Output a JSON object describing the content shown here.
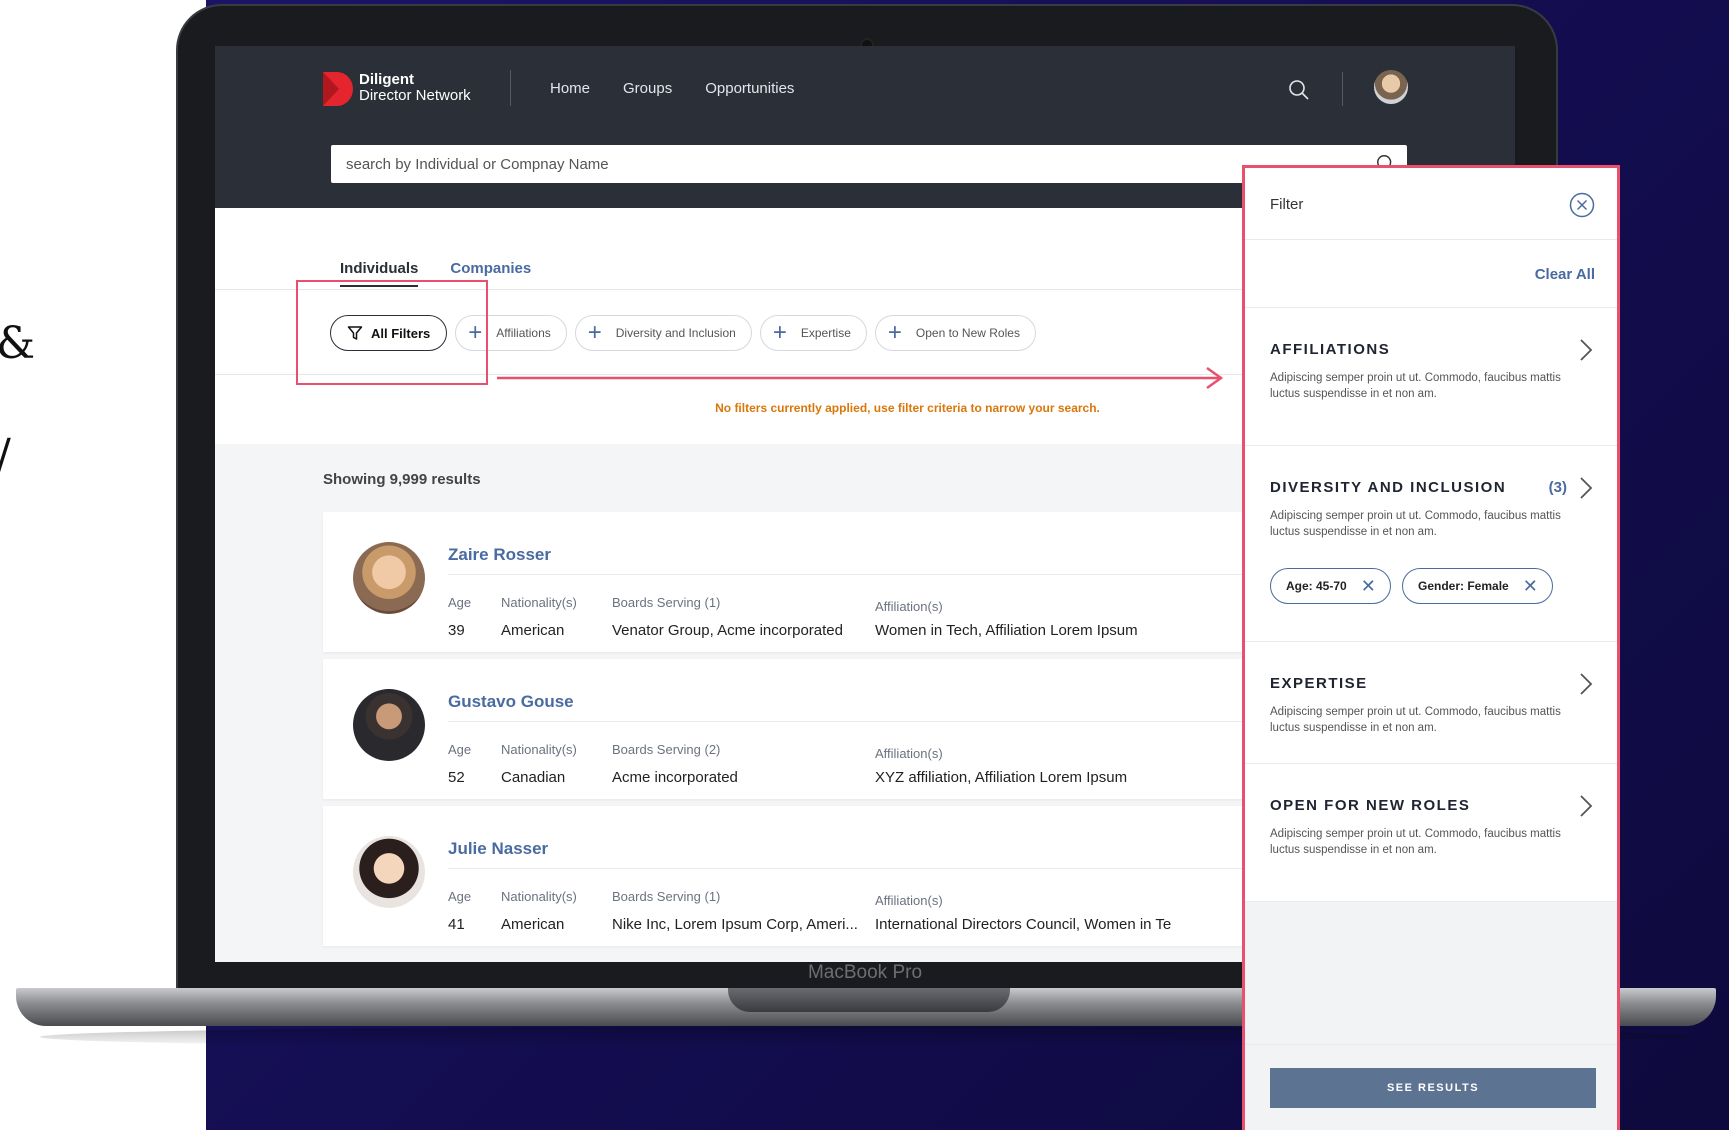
{
  "side_glyphs": [
    "&",
    "/"
  ],
  "app": {
    "logo_line1": "Diligent",
    "logo_line2": "Director Network",
    "nav": [
      "Home",
      "Groups",
      "Opportunities"
    ],
    "search_placeholder": "search by Individual or Compnay Name"
  },
  "tabs": [
    "Individuals",
    "Companies"
  ],
  "filters": {
    "all": "All Filters",
    "chips": [
      "Affiliations",
      "Diversity and Inclusion",
      "Expertise",
      "Open to New Roles"
    ],
    "notice": "No filters currently applied, use filter criteria to narrow your search."
  },
  "results": {
    "showing": "Showing 9,999 results",
    "labels": {
      "age": "Age",
      "nationality": "Nationality(s)",
      "affiliations": "Affiliation(s)"
    },
    "people": [
      {
        "name": "Zaire Rosser",
        "age": "39",
        "nationality": "American",
        "boards_label": "Boards Serving (1)",
        "boards": "Venator Group,  Acme incorporated",
        "affiliations": "Women in Tech,  Affiliation Lorem Ipsum"
      },
      {
        "name": "Gustavo Gouse",
        "age": "52",
        "nationality": "Canadian",
        "boards_label": "Boards Serving (2)",
        "boards": "Acme incorporated",
        "affiliations": "XYZ affiliation,  Affiliation Lorem Ipsum"
      },
      {
        "name": "Julie Nasser",
        "age": "41",
        "nationality": "American",
        "boards_label": "Boards Serving (1)",
        "boards": "Nike Inc, Lorem Ipsum Corp, Ameri...",
        "affiliations": "International Directors Council,  Women in Te"
      }
    ]
  },
  "filter_panel": {
    "title": "Filter",
    "clear_all": "Clear All",
    "sections": [
      {
        "title": "AFFILIATIONS",
        "desc": "Adipiscing semper proin ut ut. Commodo, faucibus mattis luctus suspendisse in et non am."
      },
      {
        "title": "DIVERSITY AND INCLUSION",
        "count": "(3)",
        "desc": "Adipiscing semper proin ut ut. Commodo, faucibus mattis luctus suspendisse in et non am.",
        "tags": [
          "Age: 45-70",
          "Gender: Female"
        ]
      },
      {
        "title": "EXPERTISE",
        "desc": "Adipiscing semper proin ut ut. Commodo, faucibus mattis luctus suspendisse in et non am."
      },
      {
        "title": "OPEN FOR NEW ROLES",
        "desc": "Adipiscing semper proin ut ut. Commodo, faucibus mattis luctus suspendisse in et non am."
      }
    ],
    "cta": "SEE RESULTS"
  },
  "device_label": "MacBook Pro",
  "colors": {
    "accent": "#4a6ba0",
    "highlight": "#e8506e",
    "notice": "#d9770a",
    "topbar": "#2a2f38",
    "background": "#150f55"
  }
}
